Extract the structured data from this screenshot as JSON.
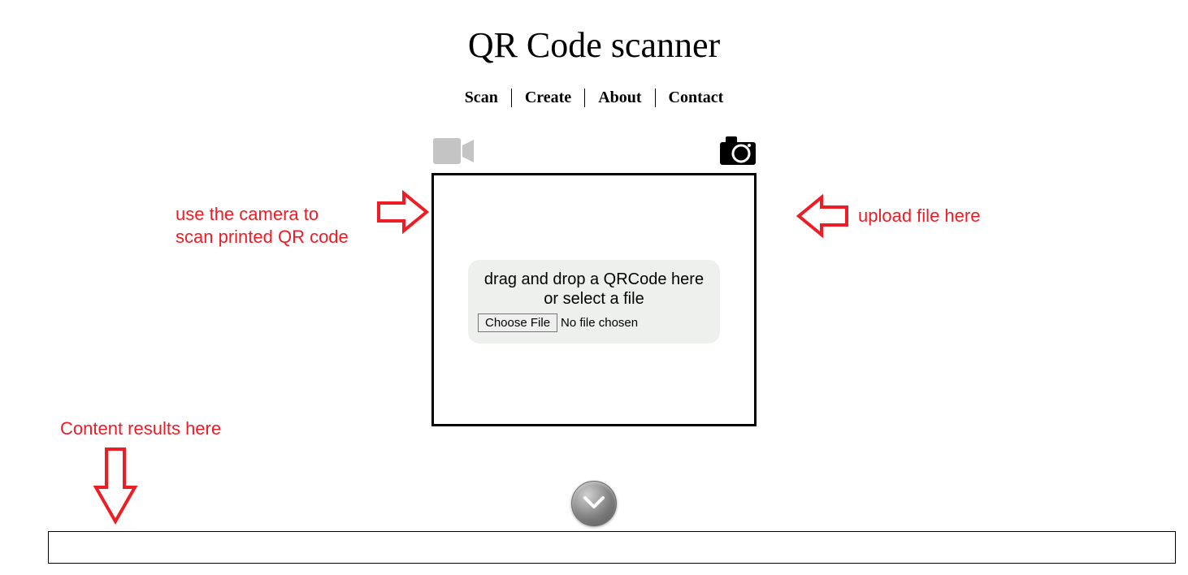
{
  "title": "QR Code scanner",
  "nav": {
    "items": [
      "Scan",
      "Create",
      "About",
      "Contact"
    ]
  },
  "icons": {
    "camera": "video-camera-icon",
    "upload": "photo-camera-icon"
  },
  "dropzone": {
    "line1": "drag and drop a QRCode here",
    "line2": "or select a file",
    "choose_label": "Choose File",
    "file_status": "No file chosen"
  },
  "annotations": {
    "camera_hint_line1": "use the camera to",
    "camera_hint_line2": "scan printed QR code",
    "upload_hint": "upload file here",
    "results_hint": "Content results here"
  },
  "results": {
    "value": ""
  }
}
